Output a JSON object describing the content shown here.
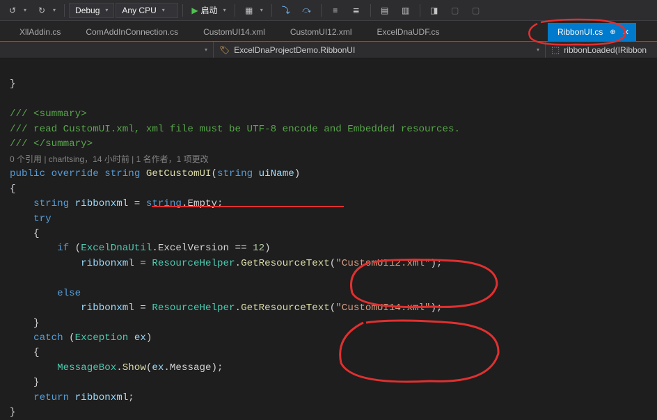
{
  "toolbar": {
    "config_label": "Debug",
    "platform_label": "Any CPU",
    "start_label": "启动"
  },
  "tabs": {
    "t1": "XllAddin.cs",
    "t2": "ComAddInConnection.cs",
    "t3": "CustomUI14.xml",
    "t4": "CustomUI12.xml",
    "t5": "ExcelDnaUDF.cs",
    "active": "RibbonUI.cs"
  },
  "navbar": {
    "class": "ExcelDnaProjectDemo.RibbonUI",
    "method": "ribbonLoaded(IRibbon"
  },
  "code": {
    "l1": "}",
    "c1": "/// <summary>",
    "c2": "/// read CustomUI.xml, xml file must be UTF-8 encode and Embedded resources.",
    "c3": "/// </summary>",
    "lens": "0 个引用 | charltsing，14 小时前 | 1 名作者，1 项更改",
    "kw_public": "public",
    "kw_override": "override",
    "kw_string_ret": "string",
    "m_getcui": "GetCustomUI",
    "kw_string_p": "string",
    "p_uiname": "uiName",
    "kw_string_l": "string",
    "v_ribbonxml": "ribbonxml",
    "kw_string_e": "string",
    "prop_empty": "Empty",
    "kw_try": "try",
    "kw_if": "if",
    "t_excelutil": "ExcelDnaUtil",
    "prop_ever": "ExcelVersion",
    "n12": "12",
    "t_reshelper": "ResourceHelper",
    "m_getres": "GetResourceText",
    "s_cui12": "\"CustomUI12.xml\"",
    "kw_else": "else",
    "s_cui14": "\"CustomUI14.xml\"",
    "kw_catch": "catch",
    "t_exc": "Exception",
    "v_ex": "ex",
    "t_msgbox": "MessageBox",
    "m_show": "Show",
    "prop_msg": "Message",
    "kw_return": "return"
  }
}
